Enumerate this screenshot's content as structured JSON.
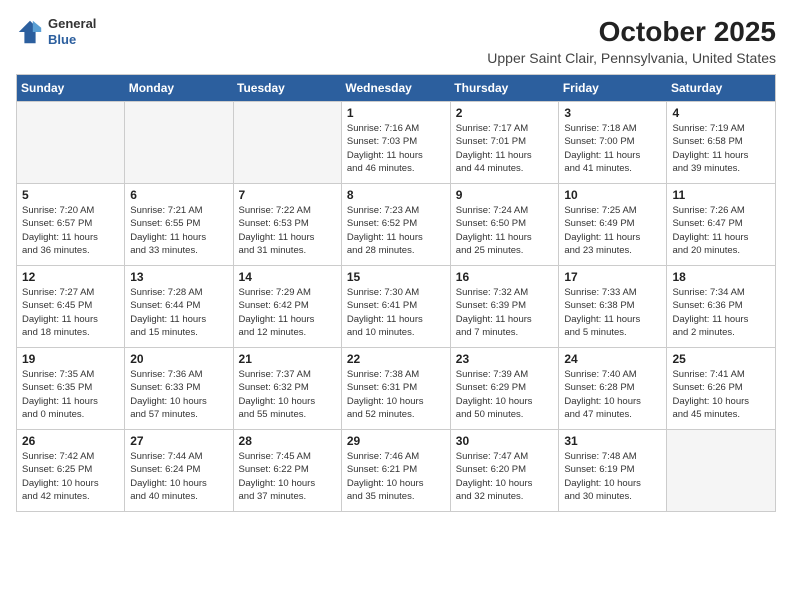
{
  "header": {
    "logo": {
      "line1": "General",
      "line2": "Blue"
    },
    "title": "October 2025",
    "location": "Upper Saint Clair, Pennsylvania, United States"
  },
  "calendar": {
    "days_of_week": [
      "Sunday",
      "Monday",
      "Tuesday",
      "Wednesday",
      "Thursday",
      "Friday",
      "Saturday"
    ],
    "weeks": [
      [
        {
          "day": "",
          "empty": true
        },
        {
          "day": "",
          "empty": true
        },
        {
          "day": "",
          "empty": true
        },
        {
          "day": "1",
          "info": "Sunrise: 7:16 AM\nSunset: 7:03 PM\nDaylight: 11 hours\nand 46 minutes."
        },
        {
          "day": "2",
          "info": "Sunrise: 7:17 AM\nSunset: 7:01 PM\nDaylight: 11 hours\nand 44 minutes."
        },
        {
          "day": "3",
          "info": "Sunrise: 7:18 AM\nSunset: 7:00 PM\nDaylight: 11 hours\nand 41 minutes."
        },
        {
          "day": "4",
          "info": "Sunrise: 7:19 AM\nSunset: 6:58 PM\nDaylight: 11 hours\nand 39 minutes."
        }
      ],
      [
        {
          "day": "5",
          "info": "Sunrise: 7:20 AM\nSunset: 6:57 PM\nDaylight: 11 hours\nand 36 minutes."
        },
        {
          "day": "6",
          "info": "Sunrise: 7:21 AM\nSunset: 6:55 PM\nDaylight: 11 hours\nand 33 minutes."
        },
        {
          "day": "7",
          "info": "Sunrise: 7:22 AM\nSunset: 6:53 PM\nDaylight: 11 hours\nand 31 minutes."
        },
        {
          "day": "8",
          "info": "Sunrise: 7:23 AM\nSunset: 6:52 PM\nDaylight: 11 hours\nand 28 minutes."
        },
        {
          "day": "9",
          "info": "Sunrise: 7:24 AM\nSunset: 6:50 PM\nDaylight: 11 hours\nand 25 minutes."
        },
        {
          "day": "10",
          "info": "Sunrise: 7:25 AM\nSunset: 6:49 PM\nDaylight: 11 hours\nand 23 minutes."
        },
        {
          "day": "11",
          "info": "Sunrise: 7:26 AM\nSunset: 6:47 PM\nDaylight: 11 hours\nand 20 minutes."
        }
      ],
      [
        {
          "day": "12",
          "info": "Sunrise: 7:27 AM\nSunset: 6:45 PM\nDaylight: 11 hours\nand 18 minutes."
        },
        {
          "day": "13",
          "info": "Sunrise: 7:28 AM\nSunset: 6:44 PM\nDaylight: 11 hours\nand 15 minutes."
        },
        {
          "day": "14",
          "info": "Sunrise: 7:29 AM\nSunset: 6:42 PM\nDaylight: 11 hours\nand 12 minutes."
        },
        {
          "day": "15",
          "info": "Sunrise: 7:30 AM\nSunset: 6:41 PM\nDaylight: 11 hours\nand 10 minutes."
        },
        {
          "day": "16",
          "info": "Sunrise: 7:32 AM\nSunset: 6:39 PM\nDaylight: 11 hours\nand 7 minutes."
        },
        {
          "day": "17",
          "info": "Sunrise: 7:33 AM\nSunset: 6:38 PM\nDaylight: 11 hours\nand 5 minutes."
        },
        {
          "day": "18",
          "info": "Sunrise: 7:34 AM\nSunset: 6:36 PM\nDaylight: 11 hours\nand 2 minutes."
        }
      ],
      [
        {
          "day": "19",
          "info": "Sunrise: 7:35 AM\nSunset: 6:35 PM\nDaylight: 11 hours\nand 0 minutes."
        },
        {
          "day": "20",
          "info": "Sunrise: 7:36 AM\nSunset: 6:33 PM\nDaylight: 10 hours\nand 57 minutes."
        },
        {
          "day": "21",
          "info": "Sunrise: 7:37 AM\nSunset: 6:32 PM\nDaylight: 10 hours\nand 55 minutes."
        },
        {
          "day": "22",
          "info": "Sunrise: 7:38 AM\nSunset: 6:31 PM\nDaylight: 10 hours\nand 52 minutes."
        },
        {
          "day": "23",
          "info": "Sunrise: 7:39 AM\nSunset: 6:29 PM\nDaylight: 10 hours\nand 50 minutes."
        },
        {
          "day": "24",
          "info": "Sunrise: 7:40 AM\nSunset: 6:28 PM\nDaylight: 10 hours\nand 47 minutes."
        },
        {
          "day": "25",
          "info": "Sunrise: 7:41 AM\nSunset: 6:26 PM\nDaylight: 10 hours\nand 45 minutes."
        }
      ],
      [
        {
          "day": "26",
          "info": "Sunrise: 7:42 AM\nSunset: 6:25 PM\nDaylight: 10 hours\nand 42 minutes."
        },
        {
          "day": "27",
          "info": "Sunrise: 7:44 AM\nSunset: 6:24 PM\nDaylight: 10 hours\nand 40 minutes."
        },
        {
          "day": "28",
          "info": "Sunrise: 7:45 AM\nSunset: 6:22 PM\nDaylight: 10 hours\nand 37 minutes."
        },
        {
          "day": "29",
          "info": "Sunrise: 7:46 AM\nSunset: 6:21 PM\nDaylight: 10 hours\nand 35 minutes."
        },
        {
          "day": "30",
          "info": "Sunrise: 7:47 AM\nSunset: 6:20 PM\nDaylight: 10 hours\nand 32 minutes."
        },
        {
          "day": "31",
          "info": "Sunrise: 7:48 AM\nSunset: 6:19 PM\nDaylight: 10 hours\nand 30 minutes."
        },
        {
          "day": "",
          "empty": true
        }
      ]
    ]
  }
}
